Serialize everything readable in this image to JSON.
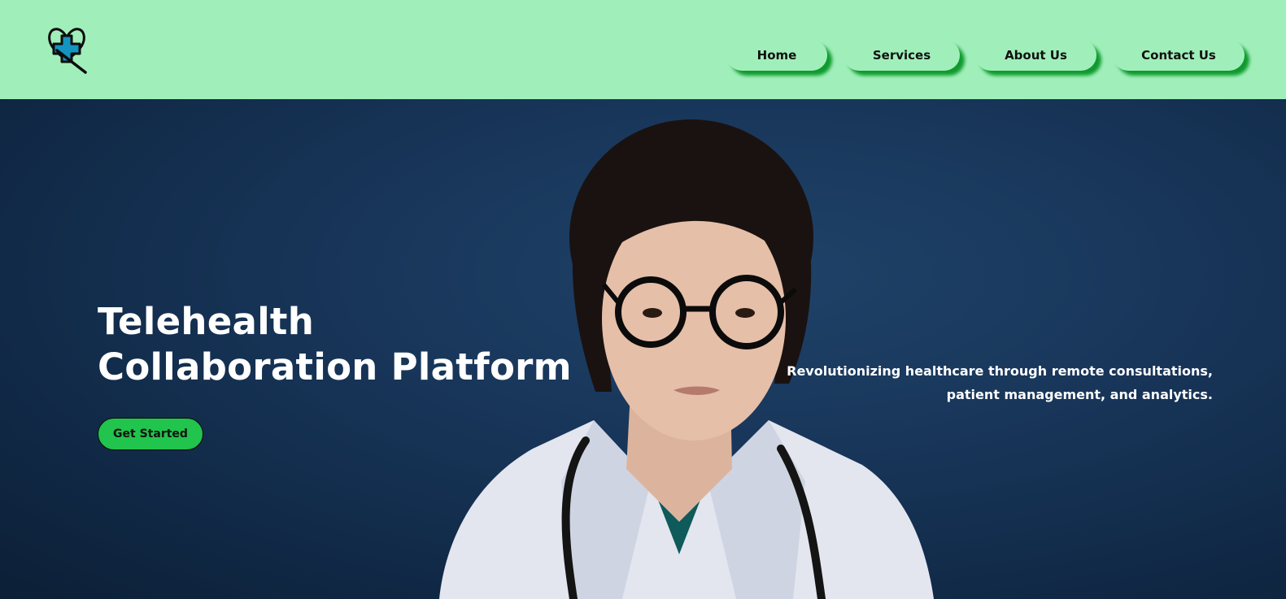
{
  "header": {
    "logo_icon": "heart-medical-cross-icon",
    "nav": [
      {
        "label": "Home"
      },
      {
        "label": "Services"
      },
      {
        "label": "About Us"
      },
      {
        "label": "Contact Us"
      }
    ]
  },
  "hero": {
    "title": "Telehealth Collaboration Platform",
    "cta_label": "Get Started",
    "tagline": "Revolutionizing healthcare through remote consultations, patient management, and analytics.",
    "photo_subject": "doctor-with-stethoscope-photo"
  },
  "colors": {
    "header_bg": "#a0efba",
    "nav_shadow": "#0f9a2e",
    "cta_bg": "#21c44c",
    "hero_bg": "#18365a"
  }
}
